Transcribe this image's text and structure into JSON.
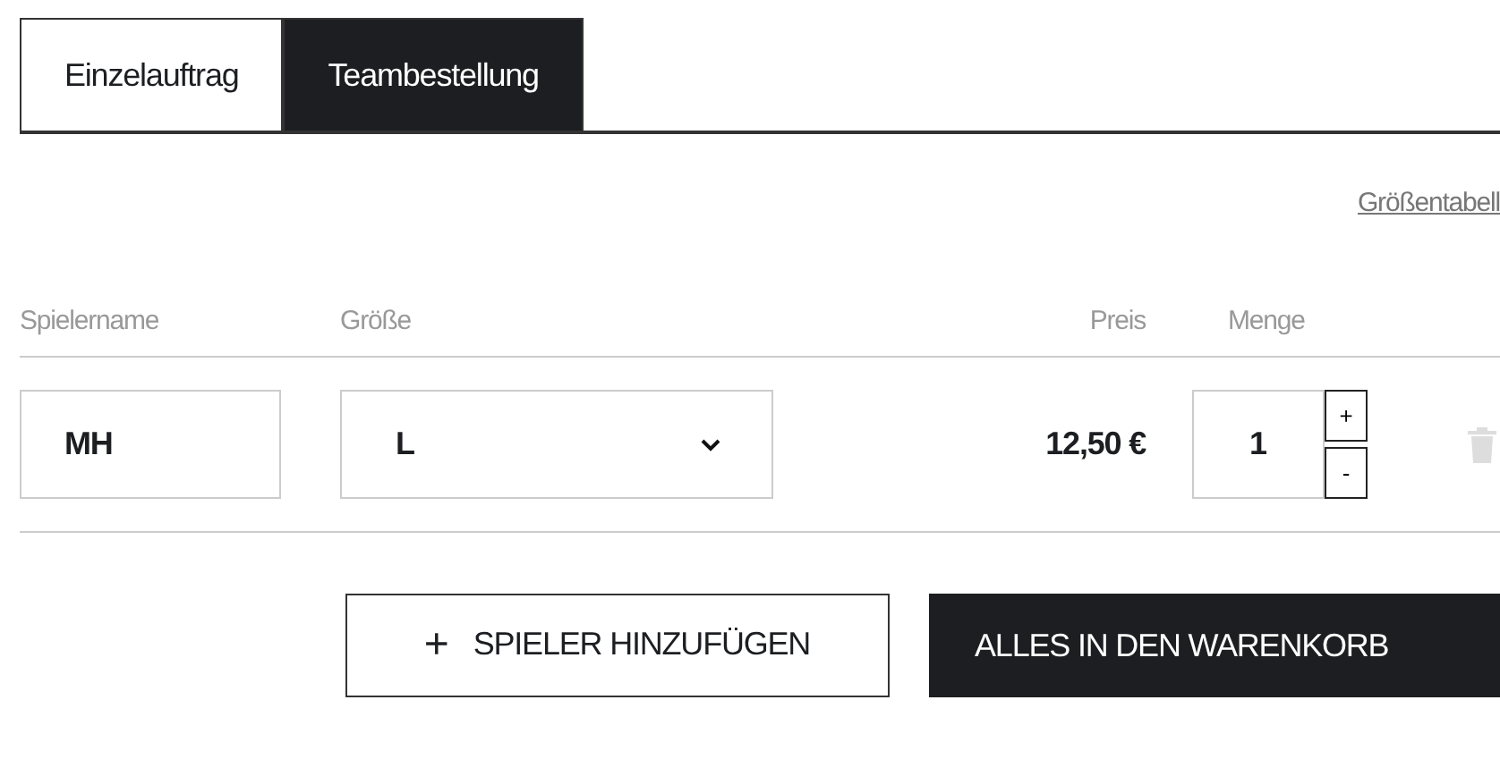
{
  "tabs": [
    {
      "label": "Einzelauftrag",
      "selected": false
    },
    {
      "label": "Teambestellung",
      "selected": true
    }
  ],
  "size_chart_link": "Größentabell",
  "columns": {
    "name": "Spielername",
    "size": "Größe",
    "price": "Preis",
    "quantity": "Menge"
  },
  "rows": [
    {
      "player_name": "MH",
      "size": "L",
      "price": "12,50 €",
      "quantity": "1",
      "increment": "+",
      "decrement": "-"
    }
  ],
  "buttons": {
    "add_player": "SPIELER HINZUFÜGEN",
    "add_player_icon": "+",
    "add_all_to_cart": "ALLES IN DEN WARENKORB"
  }
}
